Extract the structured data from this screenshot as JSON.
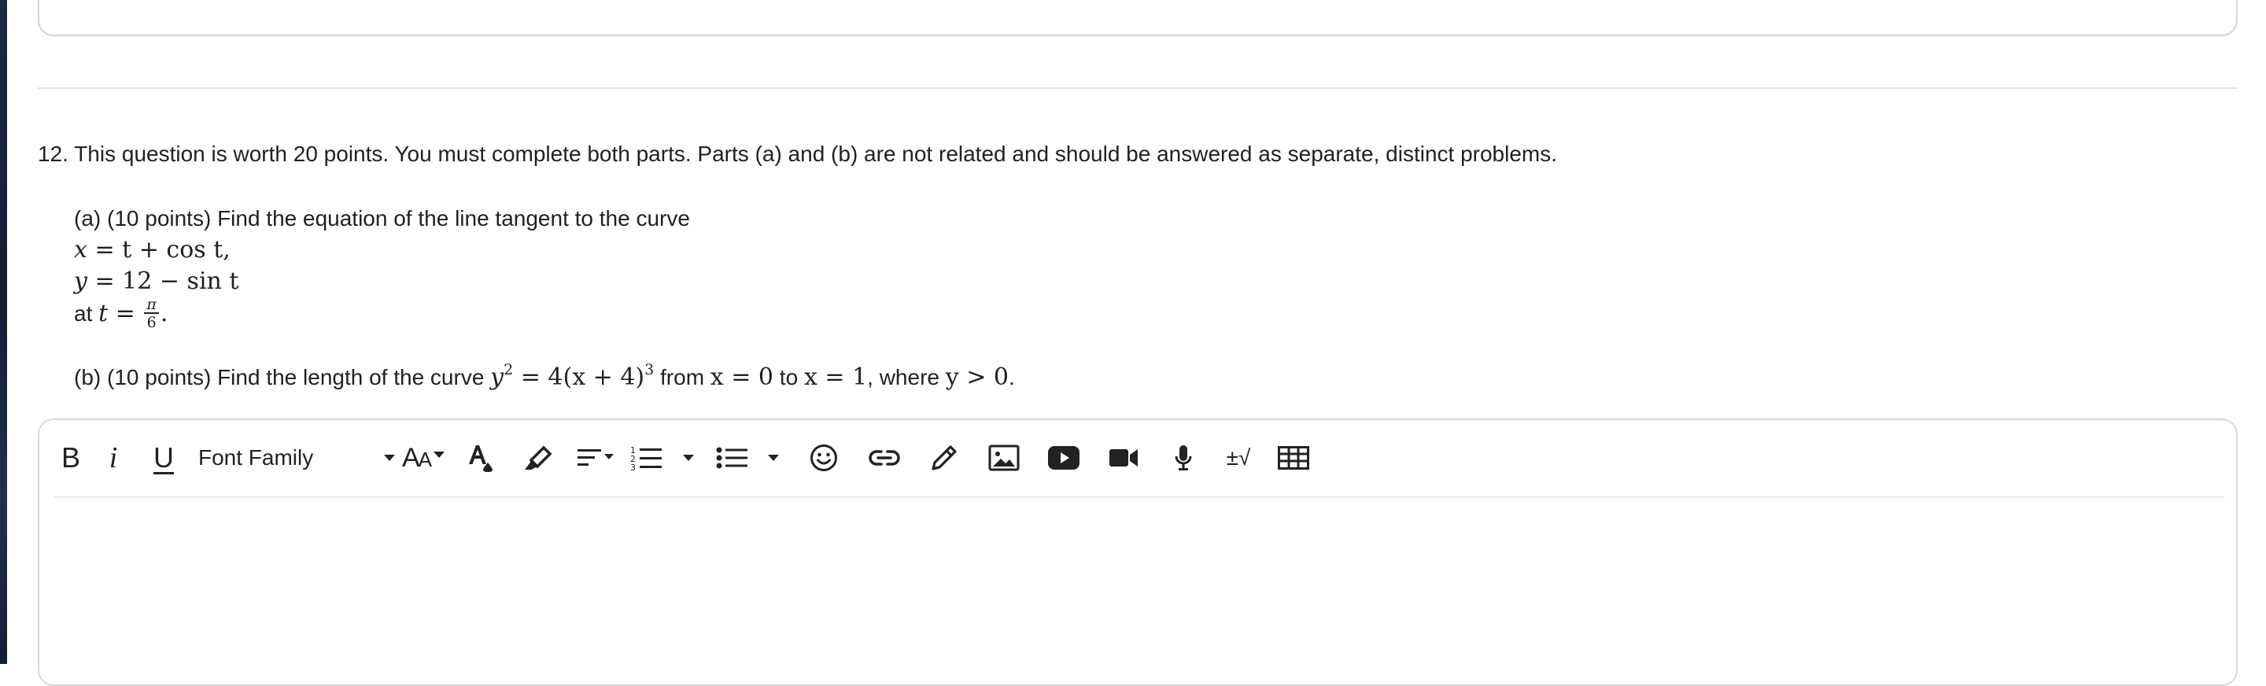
{
  "question": {
    "header": "12. This question is worth 20 points. You must complete both parts. Parts (a) and (b) are not related and should be answered as separate, distinct problems.",
    "part_a": {
      "intro": "(a) (10 points) Find the equation of the line tangent to the curve",
      "eq_x_var": "x",
      "eq_x_rest": " = t + cos t,",
      "eq_y_var": "y",
      "eq_y_rest": " = 12 − sin t",
      "at_text": "at ",
      "at_var": "t",
      "at_eq": " = ",
      "frac_num": "π",
      "frac_den": "6",
      "period": "."
    },
    "part_b": {
      "intro": "(b) (10 points) Find the length of the curve ",
      "curve_y": "y",
      "curve_y_exp": "2",
      "curve_eq": " = 4(x + 4)",
      "curve_exp": "3",
      "from_text": " from ",
      "from_expr": "x = 0",
      "to_text": " to ",
      "to_expr": "x = 1",
      "where_text": ", where ",
      "where_expr": "y > 0",
      "end": "."
    }
  },
  "editor": {
    "bold_label": "B",
    "italic_label": "i",
    "underline_label": "U",
    "font_family_label": "Font Family",
    "font_size_label": "AA",
    "plusminus_label": "±√",
    "body_text": ""
  },
  "colors": {
    "text": "#202122",
    "border": "#d6d8dc",
    "divider": "#e3e4e7",
    "icon": "#222222"
  },
  "icons": [
    "bold",
    "italic",
    "underline",
    "font-family-dropdown",
    "font-size-icon",
    "text-color-icon",
    "highlight-icon",
    "align-icon",
    "ordered-list-icon",
    "unordered-list-icon",
    "emoji-icon",
    "link-icon",
    "draw-icon",
    "image-icon",
    "youtube-icon",
    "video-icon",
    "microphone-icon",
    "math-equation-icon",
    "table-icon"
  ]
}
